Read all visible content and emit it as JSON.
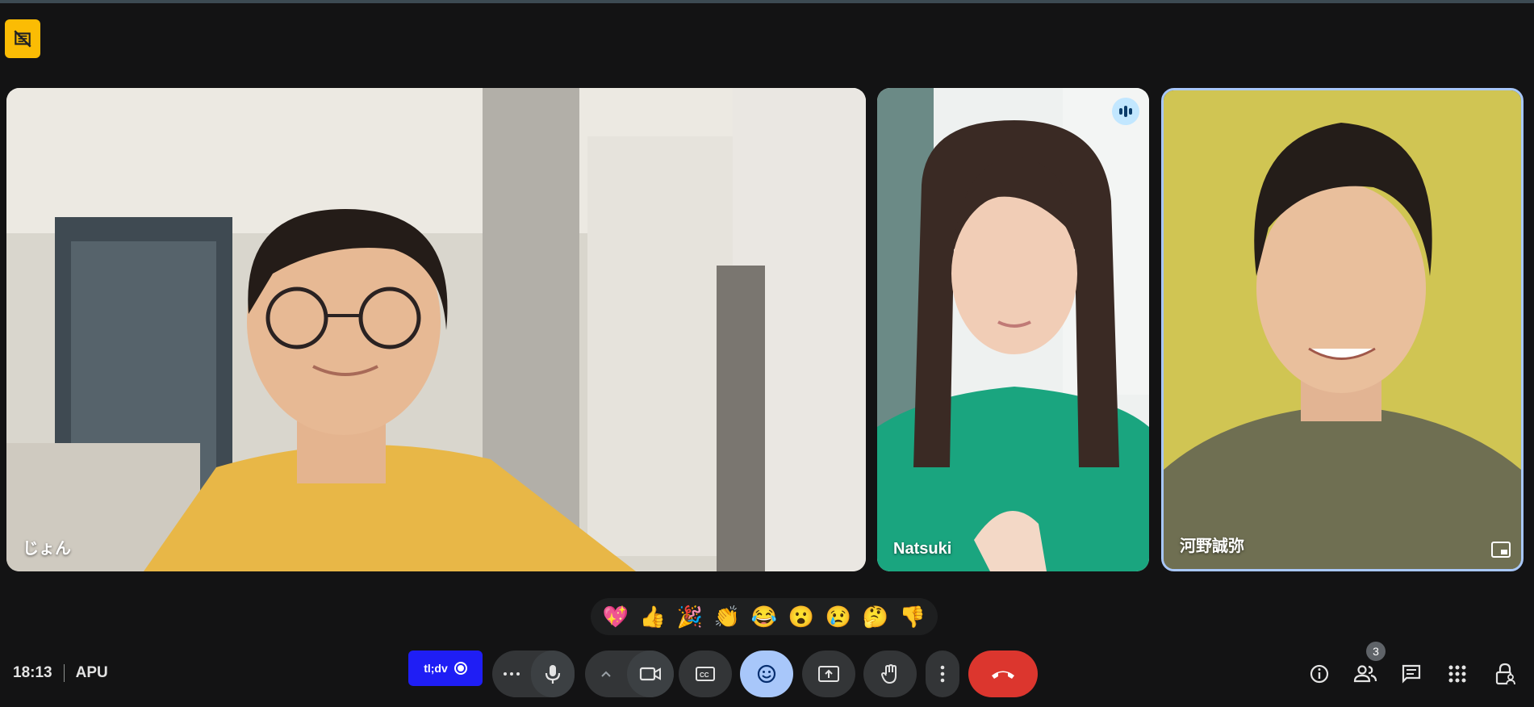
{
  "meeting": {
    "time": "18:13",
    "code": "APU"
  },
  "participants": [
    {
      "name": "じょん"
    },
    {
      "name": "Natsuki",
      "speaking": true
    },
    {
      "name": "河野誠弥",
      "pinned": true
    }
  ],
  "reactions": [
    "💖",
    "👍",
    "🎉",
    "👏",
    "😂",
    "😮",
    "😢",
    "🤔",
    "👎"
  ],
  "extension": {
    "label": "tl;dv"
  },
  "people_count": "3",
  "icons": {
    "recording_status": "no-recording-icon",
    "more_options": "more-horiz-icon",
    "mic": "mic-icon",
    "audio_options": "chevron-up-icon",
    "camera": "videocam-icon",
    "captions": "closed-caption-icon",
    "emoji": "emoji-icon",
    "present": "present-screen-icon",
    "raise_hand": "hand-icon",
    "more_vert": "more-vert-icon",
    "leave": "call-end-icon",
    "info": "info-icon",
    "people": "people-icon",
    "chat": "chat-icon",
    "activities": "apps-grid-icon",
    "host_controls": "lock-person-icon"
  },
  "colors": {
    "active_button": "#a8c7fa",
    "leave_button": "#dc362e",
    "extension": "#1f1ef5",
    "recording_badge": "#fbbc04"
  }
}
